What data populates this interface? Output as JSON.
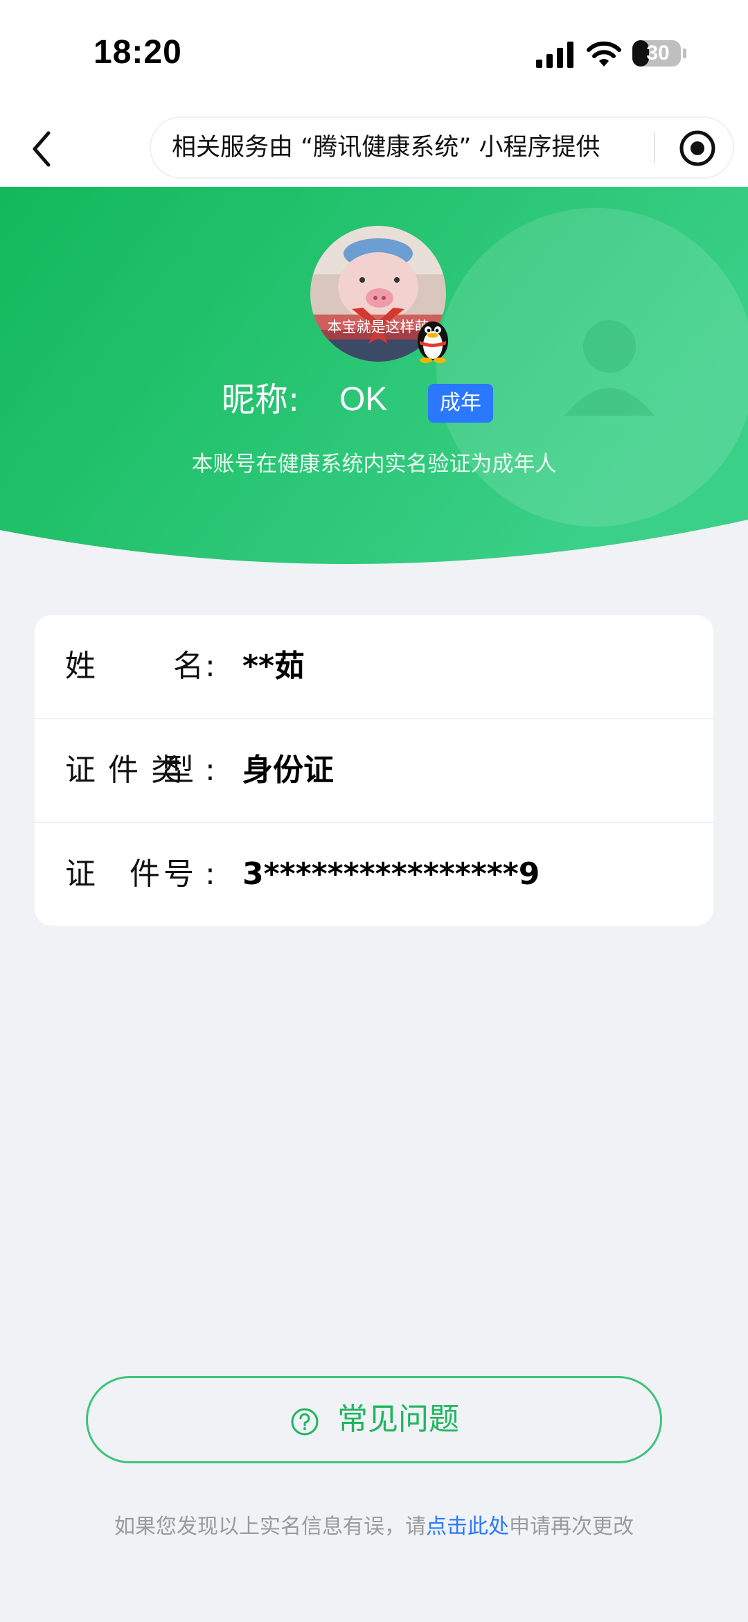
{
  "status_bar": {
    "time": "18:20",
    "battery": "30",
    "icons": [
      "signal-icon",
      "wifi-icon",
      "battery-icon"
    ]
  },
  "nav": {
    "back_icon": "chevron-left-icon",
    "service_text": "相关服务由 “腾讯健康系统” 小程序提供",
    "record_icon": "record-icon"
  },
  "profile": {
    "avatar_caption": "本宝就是这样萌",
    "nickname_label": "昵称:",
    "nickname": "OK",
    "age_badge": "成年",
    "verify_note": "本账号在健康系统内实名验证为成年人"
  },
  "info": {
    "rows": [
      {
        "label": "姓名",
        "value": "**茹"
      },
      {
        "label": "证件类型",
        "value": "身份证"
      },
      {
        "label": "证件号",
        "value": "3****************9"
      }
    ],
    "colon": ":"
  },
  "faq": {
    "icon": "question-circle-icon",
    "label": "常见问题"
  },
  "footer": {
    "prefix": "如果您发现以上实名信息有误，请",
    "link": "点击此处",
    "suffix": "申请再次更改"
  },
  "colors": {
    "brand_green": "#1fb65e",
    "hero_green": "#22c46a",
    "badge_blue": "#2a78ff",
    "background": "#f0f2f6"
  }
}
